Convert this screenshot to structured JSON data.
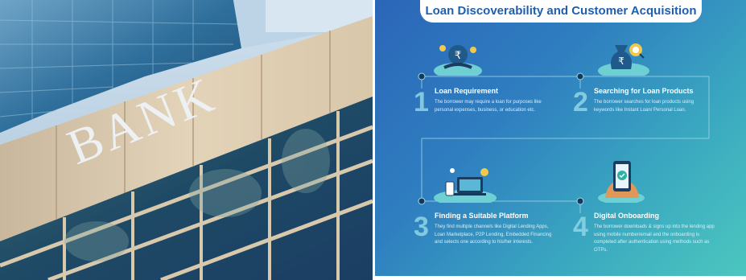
{
  "photo": {
    "sign_text": "BANK"
  },
  "infographic": {
    "title": "Loan Discoverability and Customer Acquisition",
    "steps": [
      {
        "number": "1",
        "title": "Loan Requirement",
        "description": "The borrower may require a loan for purposes like personal expenses, business, or education etc."
      },
      {
        "number": "2",
        "title": "Searching for Loan Products",
        "description": "The borrower searches for loan products using keywords like Instant Loan/ Personal Loan."
      },
      {
        "number": "3",
        "title": "Finding a Suitable Platform",
        "description": "They find multiple channels like Digital Lending Apps, Loan Marketplace, P2P Lending, Embedded Financing and selects one according to his/her interests."
      },
      {
        "number": "4",
        "title": "Digital Onboarding",
        "description": "The borrower downloads & signs up into the lending app using mobile number/email and the onboarding is completed after authentication using methods such as OTPs."
      }
    ],
    "icons": [
      "rupee-hand-coins-icon",
      "money-bag-search-icon",
      "laptop-phone-platform-icon",
      "phone-verified-hand-icon"
    ],
    "colors": {
      "banner_text": "#1f5fb0",
      "gradient_start": "#2b66b8",
      "gradient_end": "#4cc7bf",
      "accent_number": "#8fd6e6"
    }
  }
}
